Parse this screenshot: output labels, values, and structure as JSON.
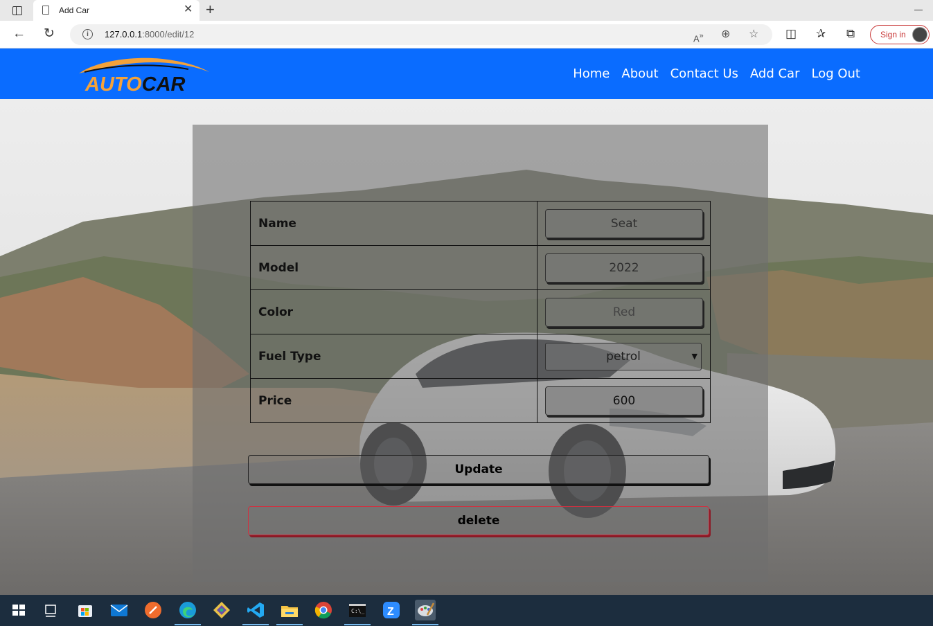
{
  "browser": {
    "tab_title": "Add Car",
    "url_host": "127.0.0.1",
    "url_path": ":8000/edit/12",
    "signin_label": "Sign in"
  },
  "site": {
    "logo_part1": "AUTO",
    "logo_part2": "CAR",
    "nav": [
      "Home",
      "About",
      "Contact Us",
      "Add Car",
      "Log Out"
    ]
  },
  "form": {
    "rows": [
      {
        "label": "Name",
        "value": "Seat"
      },
      {
        "label": "Model",
        "value": "2022"
      },
      {
        "label": "Color",
        "value": "Red"
      },
      {
        "label": "Fuel Type",
        "value": "petrol"
      },
      {
        "label": "Price",
        "value": "600"
      }
    ],
    "update_label": "Update",
    "delete_label": "delete"
  },
  "colors": {
    "navbar": "#0a6cff",
    "logo_orange": "#f4a23a",
    "delete_border": "#d03040",
    "signin": "#c83737",
    "taskbar": "#1c2d3e"
  },
  "taskbar_icons": [
    "windows-start-icon",
    "task-view-icon",
    "store-icon",
    "mail-icon",
    "postman-icon",
    "edge-icon",
    "git-icon",
    "vscode-icon",
    "file-explorer-icon",
    "chrome-icon",
    "terminal-icon",
    "zoom-icon",
    "paint-icon"
  ]
}
